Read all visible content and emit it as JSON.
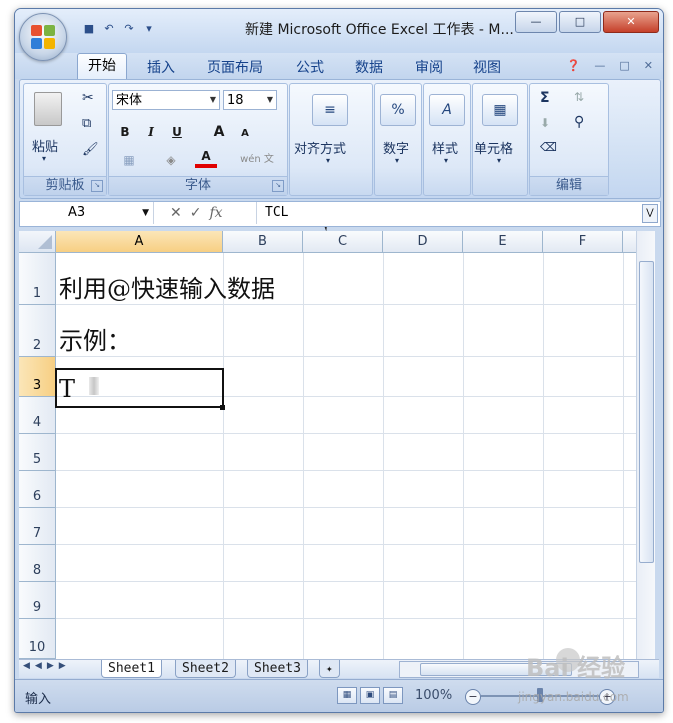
{
  "window": {
    "title": "新建 Microsoft Office Excel 工作表 - M..."
  },
  "ribbon_tabs": [
    "开始",
    "插入",
    "页面布局",
    "公式",
    "数据",
    "审阅",
    "视图"
  ],
  "ribbon": {
    "clipboard": {
      "paste_label": "粘贴",
      "group_label": "剪贴板"
    },
    "font": {
      "font_name": "宋体",
      "font_size": "18",
      "bold": "B",
      "italic": "I",
      "underline": "U",
      "grow": "A",
      "shrink": "A",
      "font_color": "A",
      "phonetic": "wén 文",
      "group_label": "字体"
    },
    "alignment": {
      "label": "对齐方式"
    },
    "number": {
      "label": "数字",
      "icon": "%"
    },
    "styles": {
      "label": "样式"
    },
    "cells": {
      "label": "单元格"
    },
    "editing": {
      "group_label": "编辑",
      "sum_icon": "Σ"
    }
  },
  "formula_bar": {
    "name_box": "A3",
    "fx": "fx",
    "content": "TCL"
  },
  "sheet": {
    "columns": [
      "A",
      "B",
      "C",
      "D",
      "E",
      "F"
    ],
    "rows": [
      "1",
      "2",
      "3",
      "4",
      "5",
      "6",
      "7",
      "8",
      "9",
      "10"
    ],
    "cells": {
      "A1": "利用@快速输入数据",
      "A2": "示例：",
      "A3": "T"
    },
    "active_cell": "A3",
    "selected_column": "A",
    "selected_row": "3"
  },
  "sheet_tabs": [
    "Sheet1",
    "Sheet2",
    "Sheet3"
  ],
  "active_sheet": "Sheet1",
  "status_bar": {
    "mode": "输入",
    "zoom": "100%"
  },
  "watermark": {
    "brand": "Bai 经验",
    "url": "jingyan.baidu.com"
  },
  "colors": {
    "selected_header": "#f7cf83",
    "ribbon_blue": "#c3d6f0",
    "font_color_bar": "#e00000",
    "close_button": "#c5402a"
  }
}
